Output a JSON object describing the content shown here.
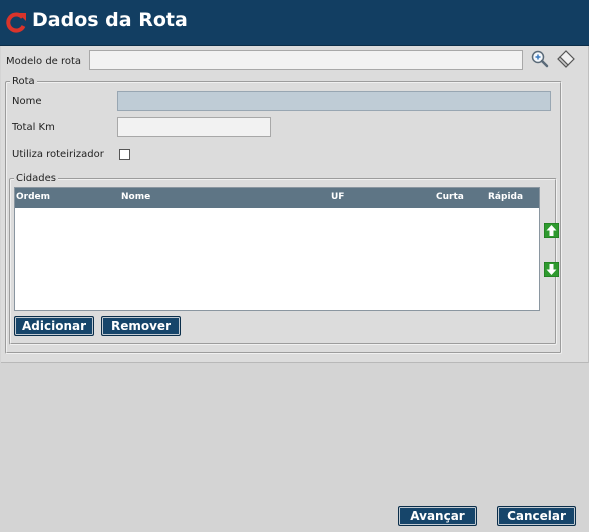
{
  "window": {
    "title": "Dados da Rota"
  },
  "form": {
    "model_label": "Modelo de rota",
    "model_value": "",
    "rota_legend": "Rota",
    "nome_label": "Nome",
    "nome_value": "",
    "total_km_label": "Total Km",
    "total_km_value": "",
    "roteirizador_label": "Utiliza roteirizador",
    "roteirizador_checked": false
  },
  "cidades": {
    "legend": "Cidades",
    "columns": [
      "Ordem",
      "Nome",
      "UF",
      "Curta",
      "Rápida"
    ],
    "rows": [],
    "add_label": "Adicionar",
    "remove_label": "Remover"
  },
  "footer": {
    "next_label": "Avançar",
    "cancel_label": "Cancelar"
  },
  "icons": {
    "title": "refresh-icon",
    "search": "zoom-in-icon",
    "clear": "eraser-icon",
    "up": "arrow-up-icon",
    "down": "arrow-down-icon"
  },
  "colors": {
    "titlebar": "#123e62",
    "button": "#16456a",
    "grid_header": "#5e7585",
    "arrow_green": "#2e9a2e",
    "icon_red": "#d9342b"
  }
}
